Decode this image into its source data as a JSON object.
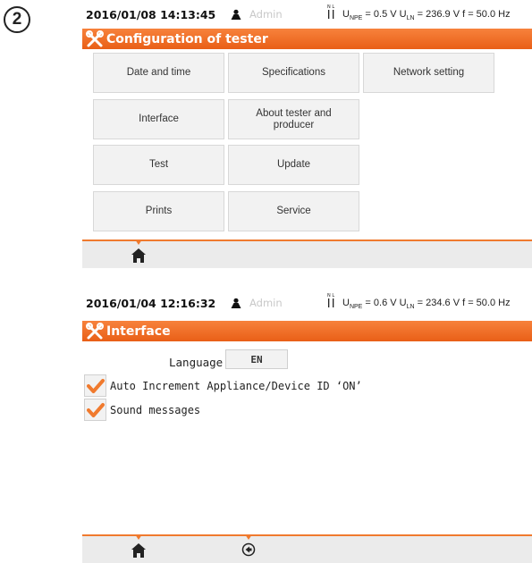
{
  "step_number": "2",
  "screen1": {
    "datetime": "2016/01/08 14:13:45",
    "user": "Admin",
    "nl_label": "N L",
    "measurements": {
      "u_npe_label": "U",
      "u_npe_sub": "NPE",
      "u_npe_value": "= 0.5 V",
      "u_ln_label": "U",
      "u_ln_sub": "LN",
      "u_ln_value": "= 236.9 V",
      "freq": "f = 50.0 Hz"
    },
    "title": "Configuration of tester",
    "menu": [
      {
        "id": "date-and-time",
        "label": "Date and time"
      },
      {
        "id": "specifications",
        "label": "Specifications"
      },
      {
        "id": "network-setting",
        "label": "Network setting"
      },
      {
        "id": "interface",
        "label": "Interface"
      },
      {
        "id": "about-tester",
        "label": "About tester and producer"
      },
      {
        "id": "test",
        "label": "Test"
      },
      {
        "id": "update",
        "label": "Update"
      },
      {
        "id": "prints",
        "label": "Prints"
      },
      {
        "id": "service",
        "label": "Service"
      }
    ],
    "icons": {
      "title": "tools-icon",
      "user": "user-icon",
      "home": "home-icon"
    }
  },
  "screen2": {
    "datetime": "2016/01/04 12:16:32",
    "user": "Admin",
    "nl_label": "N L",
    "measurements": {
      "u_npe_label": "U",
      "u_npe_sub": "NPE",
      "u_npe_value": "= 0.6 V",
      "u_ln_label": "U",
      "u_ln_sub": "LN",
      "u_ln_value": "= 234.6 V",
      "freq": "f = 50.0 Hz"
    },
    "title": "Interface",
    "language_label": "Language",
    "language_value": "EN",
    "options": [
      {
        "label": "Auto Increment Appliance/Device ID ‘ON’",
        "checked": true
      },
      {
        "label": "Sound messages",
        "checked": true
      }
    ],
    "icons": {
      "title": "tools-icon",
      "home": "home-icon",
      "back": "back-icon"
    }
  },
  "colors": {
    "accent": "#F07A2E",
    "button_bg": "#F2F2F2",
    "bottom_bar": "#EBEBEB",
    "user_disabled": "#C8C8C8"
  }
}
